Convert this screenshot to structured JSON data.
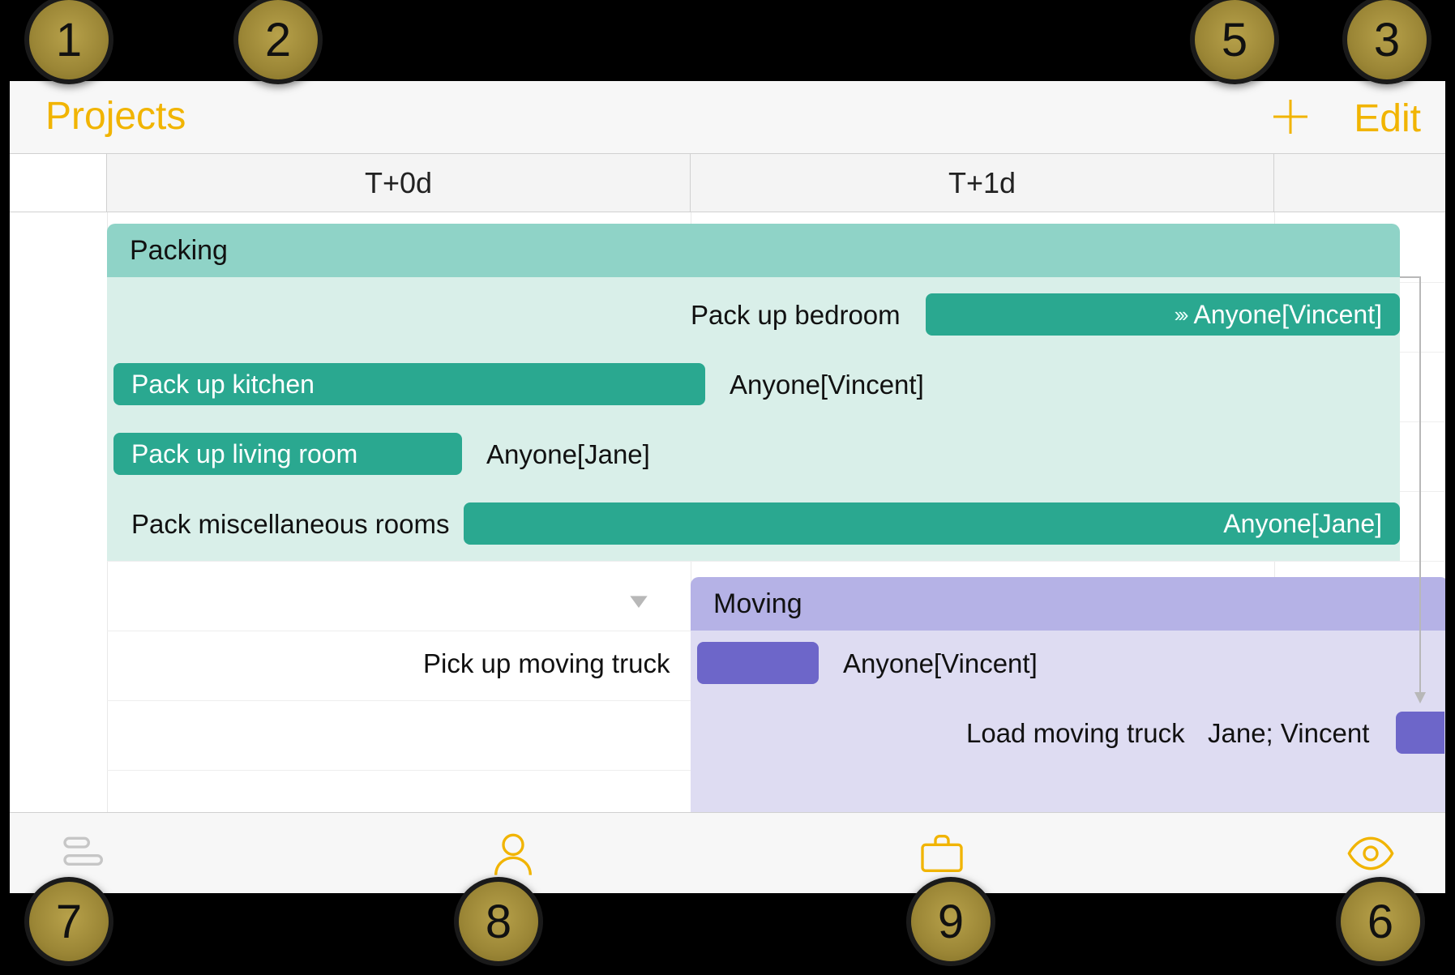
{
  "nav": {
    "back_label": "Projects",
    "edit_label": "Edit"
  },
  "timeline": {
    "columns": [
      "T+0d",
      "T+1d"
    ]
  },
  "groups": {
    "packing": {
      "title": "Packing",
      "tasks": {
        "bedroom": {
          "label": "Pack up bedroom",
          "assignee": "Anyone[Vincent]"
        },
        "kitchen": {
          "label": "Pack up kitchen",
          "assignee": "Anyone[Vincent]"
        },
        "living": {
          "label": "Pack up living room",
          "assignee": "Anyone[Jane]"
        },
        "misc": {
          "label": "Pack miscellaneous rooms",
          "assignee": "Anyone[Jane]"
        }
      }
    },
    "moving": {
      "title": "Moving",
      "tasks": {
        "pickup": {
          "label": "Pick up moving truck",
          "assignee": "Anyone[Vincent]"
        },
        "load": {
          "label": "Load moving truck",
          "assignee": "Jane; Vincent"
        }
      }
    }
  },
  "callouts": [
    "1",
    "2",
    "3",
    "5",
    "6",
    "7",
    "8",
    "9"
  ]
}
